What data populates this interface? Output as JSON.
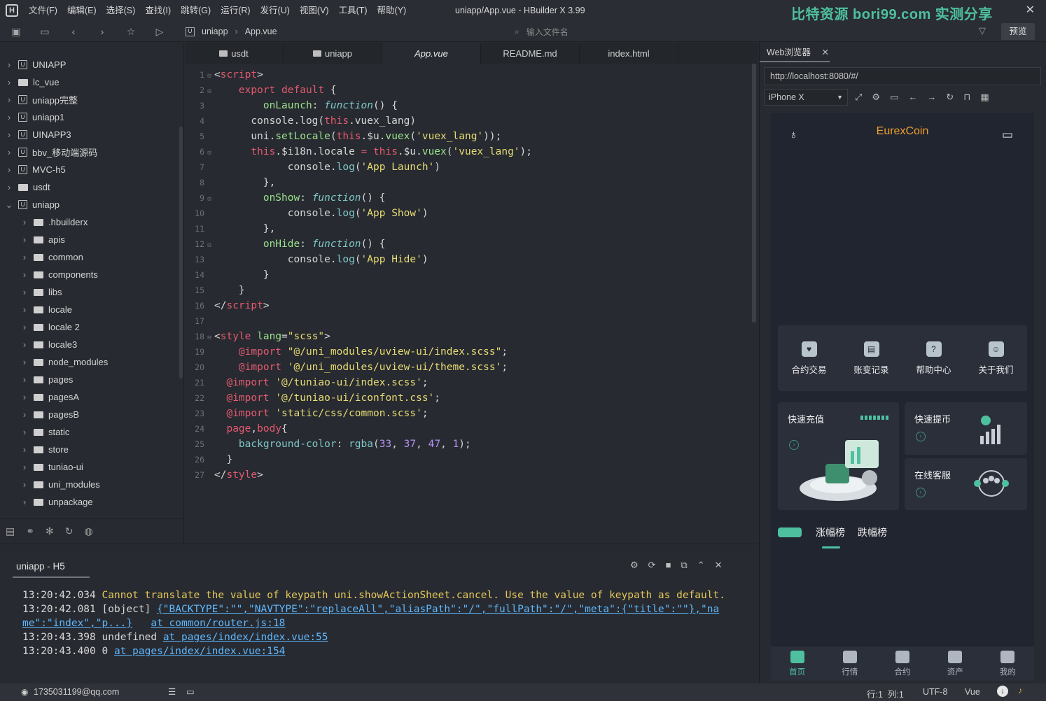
{
  "titlebar": {
    "menu": [
      "文件(F)",
      "编辑(E)",
      "选择(S)",
      "查找(I)",
      "跳转(G)",
      "运行(R)",
      "发行(U)",
      "视图(V)",
      "工具(T)",
      "帮助(Y)"
    ],
    "window_title": "uniapp/App.vue - HBuilder X 3.99",
    "watermark": "比特资源 bori99.com 实测分享"
  },
  "toolbar": {
    "crumb_project": "uniapp",
    "crumb_file": "App.vue",
    "file_search_placeholder": "输入文件名",
    "preview_label": "预览"
  },
  "sidebar": {
    "items": [
      {
        "label": "UNIAPP",
        "type": "proj",
        "depth": 0,
        "open": false
      },
      {
        "label": "lc_vue",
        "type": "folder",
        "depth": 0,
        "open": false
      },
      {
        "label": "uniapp完整",
        "type": "proj",
        "depth": 0,
        "open": false
      },
      {
        "label": "uniapp1",
        "type": "proj",
        "depth": 0,
        "open": false
      },
      {
        "label": "UINAPP3",
        "type": "proj",
        "depth": 0,
        "open": false
      },
      {
        "label": "bbv_移动端源码",
        "type": "proj",
        "depth": 0,
        "open": false
      },
      {
        "label": "MVC-h5",
        "type": "proj",
        "depth": 0,
        "open": false
      },
      {
        "label": "usdt",
        "type": "folder",
        "depth": 0,
        "open": false
      },
      {
        "label": "uniapp",
        "type": "proj",
        "depth": 0,
        "open": true
      },
      {
        "label": ".hbuilderx",
        "type": "folder",
        "depth": 1,
        "open": false
      },
      {
        "label": "apis",
        "type": "folder",
        "depth": 1,
        "open": false
      },
      {
        "label": "common",
        "type": "folder",
        "depth": 1,
        "open": false
      },
      {
        "label": "components",
        "type": "folder",
        "depth": 1,
        "open": false
      },
      {
        "label": "libs",
        "type": "folder",
        "depth": 1,
        "open": false
      },
      {
        "label": "locale",
        "type": "folder",
        "depth": 1,
        "open": false
      },
      {
        "label": "locale 2",
        "type": "folder",
        "depth": 1,
        "open": false
      },
      {
        "label": "locale3",
        "type": "folder",
        "depth": 1,
        "open": false
      },
      {
        "label": "node_modules",
        "type": "folder",
        "depth": 1,
        "open": false
      },
      {
        "label": "pages",
        "type": "folder",
        "depth": 1,
        "open": false
      },
      {
        "label": "pagesA",
        "type": "folder",
        "depth": 1,
        "open": false
      },
      {
        "label": "pagesB",
        "type": "folder",
        "depth": 1,
        "open": false
      },
      {
        "label": "static",
        "type": "folder",
        "depth": 1,
        "open": false
      },
      {
        "label": "store",
        "type": "folder",
        "depth": 1,
        "open": false
      },
      {
        "label": "tuniao-ui",
        "type": "folder",
        "depth": 1,
        "open": false
      },
      {
        "label": "uni_modules",
        "type": "folder",
        "depth": 1,
        "open": false
      },
      {
        "label": "unpackage",
        "type": "folder",
        "depth": 1,
        "open": false
      }
    ]
  },
  "tabs": [
    {
      "label": "usdt",
      "folder": true,
      "active": false
    },
    {
      "label": "uniapp",
      "folder": true,
      "active": false
    },
    {
      "label": "App.vue",
      "folder": false,
      "active": true
    },
    {
      "label": "README.md",
      "folder": false,
      "active": false
    },
    {
      "label": "index.html",
      "folder": false,
      "active": false
    }
  ],
  "code": [
    {
      "n": "1",
      "fold": true,
      "html": "<span class='pu'>&lt;</span><span class='k'>script</span><span class='pu'>&gt;</span>"
    },
    {
      "n": "2",
      "fold": true,
      "html": "    <span class='k'>export default</span> <span class='pu'>{</span>"
    },
    {
      "n": "3",
      "fold": false,
      "html": "        <span class='fn'>onLaunch</span><span class='pu'>: </span><span class='it'>function</span><span class='pu'>() {</span>"
    },
    {
      "n": "4",
      "fold": false,
      "html": "      console.log(<span class='k'>this</span>.vuex_lang)"
    },
    {
      "n": "5",
      "fold": false,
      "html": "      uni.<span class='fn'>setLocale</span>(<span class='k'>this</span>.$u.<span class='fn'>vuex</span>(<span class='s'>'vuex_lang'</span>));"
    },
    {
      "n": "6",
      "fold": true,
      "html": "      <span class='k'>this</span>.$i18n.locale <span class='k'>=</span> <span class='k'>this</span>.$u.<span class='fn'>vuex</span>(<span class='s'>'vuex_lang'</span>);"
    },
    {
      "n": "7",
      "fold": false,
      "html": "            console.<span class='f'>log</span>(<span class='s'>'App Launch'</span>)"
    },
    {
      "n": "8",
      "fold": false,
      "html": "        },"
    },
    {
      "n": "9",
      "fold": true,
      "html": "        <span class='fn'>onShow</span><span class='pu'>: </span><span class='it'>function</span><span class='pu'>() {</span>"
    },
    {
      "n": "10",
      "fold": false,
      "html": "            console.<span class='f'>log</span>(<span class='s'>'App Show'</span>)"
    },
    {
      "n": "11",
      "fold": false,
      "html": "        },"
    },
    {
      "n": "12",
      "fold": true,
      "html": "        <span class='fn'>onHide</span><span class='pu'>: </span><span class='it'>function</span><span class='pu'>() {</span>"
    },
    {
      "n": "13",
      "fold": false,
      "html": "            console.<span class='f'>log</span>(<span class='s'>'App Hide'</span>)"
    },
    {
      "n": "14",
      "fold": false,
      "html": "        }"
    },
    {
      "n": "15",
      "fold": false,
      "html": "    }"
    },
    {
      "n": "16",
      "fold": false,
      "html": "<span class='pu'>&lt;/</span><span class='k'>script</span><span class='pu'>&gt;</span>"
    },
    {
      "n": "17",
      "fold": false,
      "html": ""
    },
    {
      "n": "18",
      "fold": true,
      "html": "<span class='pu'>&lt;</span><span class='k'>style</span> <span class='fn'>lang</span>=<span class='s'>\"scss\"</span><span class='pu'>&gt;</span>"
    },
    {
      "n": "19",
      "fold": false,
      "html": "    <span class='k'>@import</span> <span class='s'>\"@/uni_modules/uview-ui/index.scss\"</span>;"
    },
    {
      "n": "20",
      "fold": false,
      "html": "    <span class='k'>@import</span> <span class='s'>'@/uni_modules/uview-ui/theme.scss'</span>;"
    },
    {
      "n": "21",
      "fold": false,
      "html": "  <span class='k'>@import</span> <span class='s'>'@/tuniao-ui/index.scss'</span>;"
    },
    {
      "n": "22",
      "fold": false,
      "html": "  <span class='k'>@import</span> <span class='s'>'@/tuniao-ui/iconfont.css'</span>;"
    },
    {
      "n": "23",
      "fold": false,
      "html": "  <span class='k'>@import</span> <span class='s'>'static/css/common.scss'</span>;"
    },
    {
      "n": "24",
      "fold": false,
      "html": "  <span class='k'>page</span>,<span class='k'>body</span>{"
    },
    {
      "n": "25",
      "fold": false,
      "html": "    <span class='f'>background-color</span>: <span class='f'>rgba</span>(<span class='nm'>33</span>, <span class='nm'>37</span>, <span class='nm'>47</span>, <span class='nm'>1</span>);"
    },
    {
      "n": "26",
      "fold": false,
      "html": "  }"
    },
    {
      "n": "27",
      "fold": false,
      "html": "<span class='pu'>&lt;/</span><span class='k'>style</span><span class='pu'>&gt;</span>"
    }
  ],
  "console": {
    "tab_label": "uniapp - H5",
    "lines": [
      {
        "time": "13:20:42.034",
        "text": "Cannot translate the value of keypath uni.showActionSheet.cancel. Use the value of keypath as default.",
        "kind": "warn",
        "link": ""
      },
      {
        "time": "13:20:42.081",
        "text": "[object]",
        "kind": "obj",
        "link": "{\"BACKTYPE\":\"\",\"NAVTYPE\":\"replaceAll\",\"aliasPath\":\"/\",\"fullPath\":\"/\",\"meta\":{\"title\":\"\"},\"na"
      },
      {
        "time": "",
        "text": "",
        "kind": "cont",
        "link": "me\":\"index\",\"p...}",
        "link2": "at common/router.js:18"
      },
      {
        "time": "13:20:43.398",
        "text": "undefined",
        "kind": "plain",
        "link": "at pages/index/index.vue:55"
      },
      {
        "time": "13:20:43.400",
        "text": "0",
        "kind": "plain",
        "link": "at pages/index/index.vue:154"
      }
    ]
  },
  "statusbar": {
    "account": "1735031199@qq.com",
    "position": "行:1  列:1",
    "encoding": "UTF-8",
    "language": "Vue"
  },
  "webpane": {
    "tab_label": "Web浏览器",
    "url": "http://localhost:8080/#/",
    "device": "iPhone X",
    "app_title": "EurexCoin",
    "quick_items": [
      "合约交易",
      "账变记录",
      "帮助中心",
      "关于我们"
    ],
    "cards": {
      "recharge": "快速充值",
      "withdraw": "快速提币",
      "service": "在线客服"
    },
    "rank_tabs": [
      "涨幅榜",
      "跌幅榜"
    ],
    "tabbar": [
      "首页",
      "行情",
      "合约",
      "资产",
      "我的"
    ]
  },
  "colors": {
    "accent": "#4ec0a0",
    "brand": "#f0a030",
    "keyword": "#e35a70",
    "string": "#e6db74",
    "link": "#5fb8ff"
  }
}
